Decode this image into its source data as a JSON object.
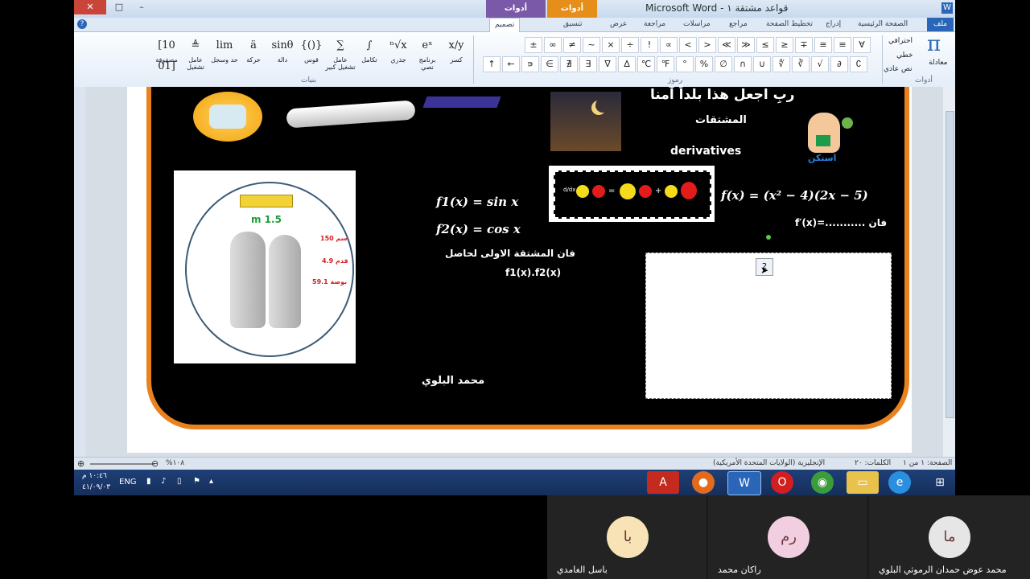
{
  "window": {
    "title": "Microsoft Word - قواعد مشتقة ١",
    "context_equation": "أدوات المعادلات",
    "context_drawing": "أدوات الرسم",
    "close": "✕",
    "min": "–",
    "max": "□"
  },
  "tabs": {
    "file": "ملف",
    "home": "الصفحة الرئيسية",
    "insert": "إدراج",
    "layout": "تخطيط الصفحة",
    "references": "مراجع",
    "mailings": "مراسلات",
    "review": "مراجعة",
    "view": "عرض",
    "format": "تنسيق",
    "design": "تصميم"
  },
  "ribbon": {
    "structures": [
      {
        "icon": "[10 01]",
        "label": "مصفوفة"
      },
      {
        "icon": "≜",
        "label": "عامل تشغيل"
      },
      {
        "icon": "lim",
        "label": "حد وسجل"
      },
      {
        "icon": "ä",
        "label": "حركة"
      },
      {
        "icon": "sinθ",
        "label": "دالة"
      },
      {
        "icon": "{()}",
        "label": "قوس"
      },
      {
        "icon": "∑",
        "label": "عامل تشغيل كبير"
      },
      {
        "icon": "∫",
        "label": "تكامل"
      },
      {
        "icon": "ⁿ√x",
        "label": "جذري"
      },
      {
        "icon": "eˣ",
        "label": "برنامج نصي"
      },
      {
        "icon": "x/y",
        "label": "كسر"
      }
    ],
    "structures_group": "بنيات",
    "symbols_row1": [
      "∀",
      "≡",
      "≅",
      "∓",
      "≥",
      "≤",
      "≫",
      "≪",
      ">",
      "<",
      "∝",
      "!",
      "÷",
      "×",
      "~",
      "≠",
      "∞",
      "±"
    ],
    "symbols_row2": [
      "↑",
      "←",
      "∍",
      "∈",
      "∄",
      "∃",
      "∇",
      "∆",
      "℃",
      "℉",
      "°",
      "%",
      "∅",
      "∩",
      "∪",
      "∜",
      "∛",
      "√",
      "∂",
      "∁"
    ],
    "symbols_group": "رموز",
    "tools": {
      "equation": "معادلة",
      "professional": "احترافي",
      "linear": "خطي",
      "normal_text": "نص عادي",
      "group": "أدوات"
    }
  },
  "slide": {
    "heading": "ربِ اجعل هذا بلداً آمنا",
    "subtitle_ar": "المشتقات",
    "subtitle_en": "derivatives",
    "stay_home": "استكن",
    "m_label": "m 1.5",
    "m150": "150 سم",
    "m49": "4.9 قدم",
    "m591": "59.1 بوصة",
    "f1": "f1(x) = sin x",
    "f2": "f2(x) = cos x",
    "q_line1": "فان المشتقة الاولى لحاصل",
    "q_line2": "f1(x).f2(x)",
    "fx": "f(x) = (x² − 4)(2x − 5)",
    "fprime": "فان ...........=f′(x)",
    "author": "محمد البلوي",
    "eq_placeholder": "2"
  },
  "status": {
    "page": "الصفحة: ١ من ١",
    "words": "الكلمات: ٢٠",
    "language": "الإنجليزية (الولايات المتحدة الأمريكية)",
    "zoom": "%١٠٨"
  },
  "taskbar": {
    "lang": "ENG",
    "time": "١٠:٤٦ م",
    "date": "٤١/٠٩/٠٣"
  },
  "participants": [
    {
      "initials": "ما",
      "name": "محمد عوض حمدان الرموثي البلوي",
      "color": "#e6e6e6"
    },
    {
      "initials": "رم",
      "name": "راكان محمد",
      "color": "#f2cfe0"
    },
    {
      "initials": "با",
      "name": "باسل الغامدي",
      "color": "#f7e3b5"
    }
  ]
}
